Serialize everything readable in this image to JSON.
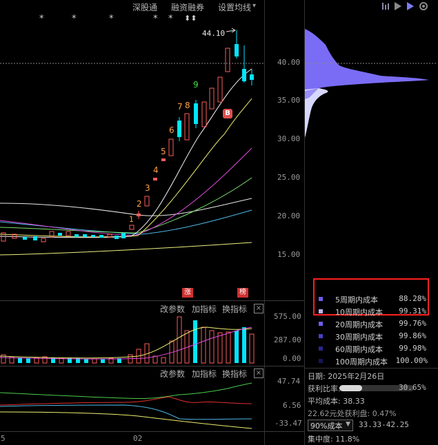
{
  "toolbar": {
    "links": [
      "深股通",
      "融资融券",
      "设置均线"
    ],
    "dropdown_arrow": "▾"
  },
  "right_toolbar_icons": [
    "chart-bars-icon",
    "flag-icon",
    "flag-active-icon",
    "settings-gear-icon"
  ],
  "star_marks": [
    "*",
    "*",
    "*",
    "*",
    "*",
    "⬍⬍"
  ],
  "price_chart": {
    "high_label": "44.10",
    "buy_marker": "B",
    "signals": [
      "涨",
      "榜"
    ],
    "td_counts": [
      "1",
      "2",
      "3",
      "4",
      "5",
      "6",
      "7",
      "8",
      "9"
    ],
    "yaxis_labels": [
      "40.00",
      "35.00",
      "30.00",
      "25.00",
      "20.00",
      "15.00"
    ]
  },
  "volume_panel": {
    "buttons": [
      "改参数",
      "加指标",
      "换指标"
    ],
    "close": "×",
    "yaxis_labels": [
      "575.00",
      "287.00",
      "0.00"
    ]
  },
  "indicator_panel": {
    "buttons": [
      "改参数",
      "加指标",
      "换指标"
    ],
    "close": "×",
    "yaxis_labels": [
      "47.74",
      "6.56",
      "-33.47"
    ]
  },
  "x_axis": {
    "labels": [
      "5",
      "02"
    ]
  },
  "cost_legend": [
    {
      "name": "5周期内成本",
      "value": "88.28%",
      "color": "#6e5cf0"
    },
    {
      "name": "10周期内成本",
      "value": "99.31%",
      "color": "#b8b4f0"
    },
    {
      "name": "20周期内成本",
      "value": "99.76%",
      "color": "#6e5cf0"
    },
    {
      "name": "30周期内成本",
      "value": "99.86%",
      "color": "#4a3fc8"
    },
    {
      "name": "60周期内成本",
      "value": "99.98%",
      "color": "#2a2590"
    },
    {
      "name": "100周期内成本",
      "value": "100.00%",
      "color": "#18165a"
    }
  ],
  "chip_info": {
    "date": "日期: 2025年2月26日",
    "profit_ratio_label": "获利比率:",
    "profit_ratio_value": "30.65%",
    "profit_ratio_fraction": 0.3065,
    "avg_cost": "平均成本: 38.33",
    "profit_at_price": "22.62元处获利盘: 0.47%",
    "cost_select": "90%成本",
    "cost_range": "33.33-42.25",
    "concentration": "集中度: 11.8%"
  },
  "colors": {
    "up": "#ff5c5c",
    "down": "#00e5ff",
    "highlight_box": "#ff2020",
    "chip": "#7a6cf5"
  }
}
